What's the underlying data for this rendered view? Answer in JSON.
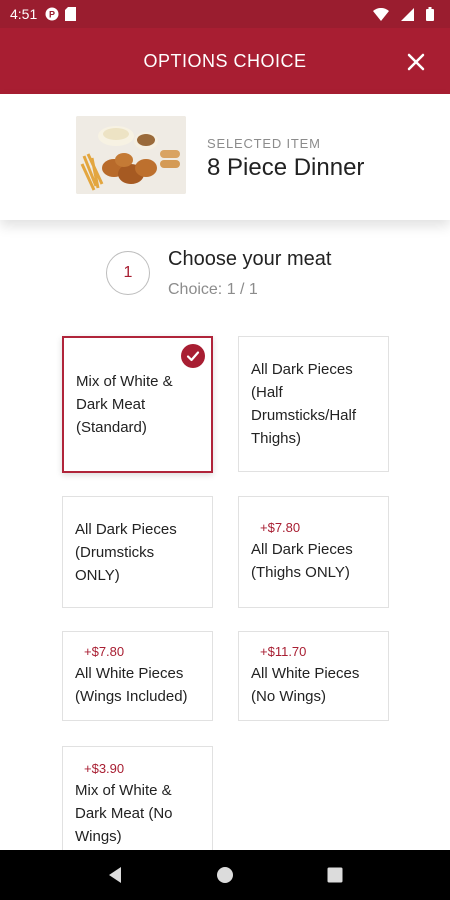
{
  "status_bar": {
    "time": "4:51",
    "icons": [
      "p-circle-icon",
      "sd-card-icon",
      "wifi-icon",
      "signal-icon",
      "battery-icon"
    ]
  },
  "header": {
    "title": "OPTIONS CHOICE",
    "close_icon": "close-icon"
  },
  "selected_item": {
    "label": "SELECTED ITEM",
    "name": "8 Piece Dinner"
  },
  "step": {
    "number": "1",
    "title": "Choose your meat",
    "subtitle": "Choice: 1 / 1"
  },
  "options": [
    {
      "label": "Mix of White & Dark Meat (Standard)",
      "price": "",
      "selected": true
    },
    {
      "label": "All Dark Pieces (Half Drumsticks/Half Thighs)",
      "price": "",
      "selected": false
    },
    {
      "label": "All Dark Pieces (Drumsticks ONLY)",
      "price": "",
      "selected": false
    },
    {
      "label": "All Dark Pieces (Thighs ONLY)",
      "price": "+$7.80",
      "selected": false
    },
    {
      "label": "All White Pieces (Wings Included)",
      "price": "+$7.80",
      "selected": false
    },
    {
      "label": "All White Pieces (No Wings)",
      "price": "+$11.70",
      "selected": false
    },
    {
      "label": "Mix of White & Dark Meat (No Wings)",
      "price": "+$3.90",
      "selected": false
    }
  ],
  "colors": {
    "brand": "#a81e32",
    "status_bar": "#9a1d2f",
    "nav_bar": "#000000"
  },
  "nav": [
    "back-icon",
    "home-icon",
    "recents-icon"
  ]
}
